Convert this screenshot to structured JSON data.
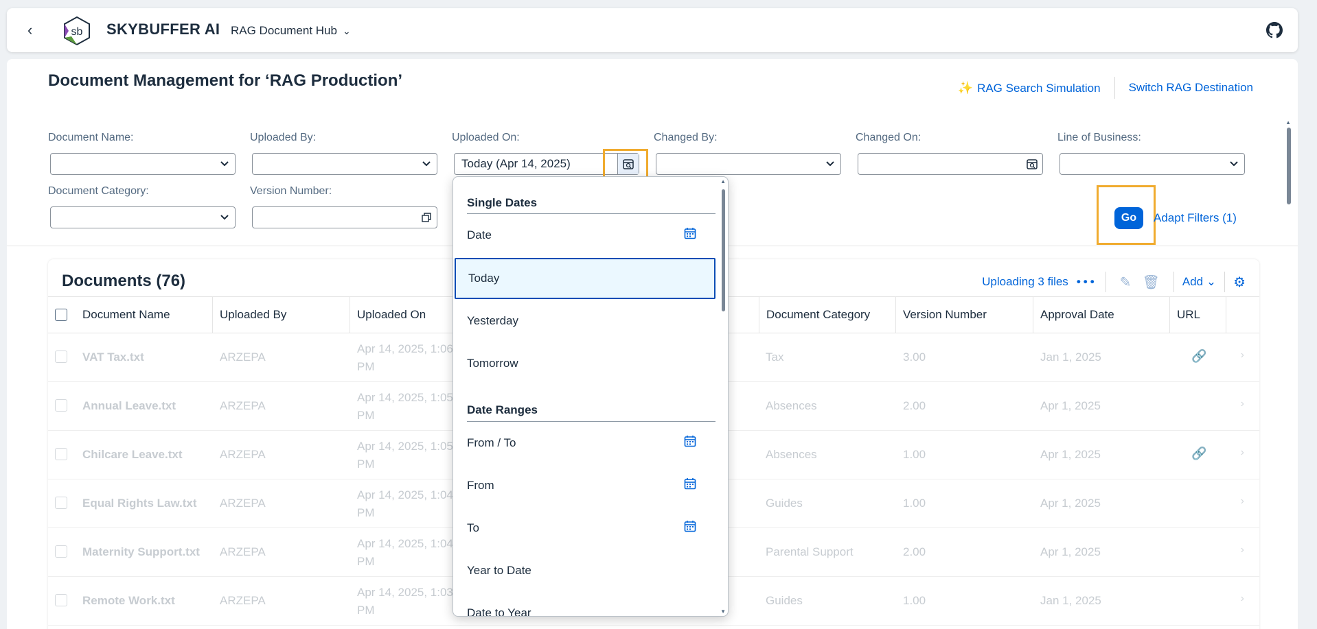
{
  "shell": {
    "brand": "SKYBUFFER AI",
    "logo_text": "sb",
    "app_title": "RAG Document Hub"
  },
  "page": {
    "title": "Document Management for ‘RAG Production’",
    "rag_search": "RAG Search Simulation",
    "switch_dest": "Switch RAG Destination"
  },
  "filters": {
    "document_name": "Document Name:",
    "uploaded_by": "Uploaded By:",
    "uploaded_on": "Uploaded On:",
    "uploaded_on_value": "Today (Apr 14, 2025)",
    "changed_by": "Changed By:",
    "changed_on": "Changed On:",
    "line_of_business": "Line of Business:",
    "document_category": "Document Category:",
    "version_number": "Version Number:",
    "go": "Go",
    "adapt": "Adapt Filters (1)"
  },
  "table": {
    "title": "Documents (76)",
    "uploading": "Uploading 3 files",
    "add": "Add",
    "columns": [
      "Document Name",
      "Uploaded By",
      "Uploaded On",
      "Document Category",
      "Version Number",
      "Approval Date",
      "URL"
    ],
    "rows": [
      {
        "name": "VAT Tax.txt",
        "by": "ARZEPA",
        "on1": "Apr 14, 2025, 1:06",
        "on2": "PM",
        "category": "Tax",
        "version": "3.00",
        "approval": "Jan 1, 2025",
        "link": true
      },
      {
        "name": "Annual Leave.txt",
        "by": "ARZEPA",
        "on1": "Apr 14, 2025, 1:05",
        "on2": "PM",
        "category": "Absences",
        "version": "2.00",
        "approval": "Apr 1, 2025",
        "link": false
      },
      {
        "name": "Chilcare Leave.txt",
        "by": "ARZEPA",
        "on1": "Apr 14, 2025, 1:05",
        "on2": "PM",
        "category": "Absences",
        "version": "1.00",
        "approval": "Apr 1, 2025",
        "link": true
      },
      {
        "name": "Equal Rights Law.txt",
        "by": "ARZEPA",
        "on1": "Apr 14, 2025, 1:04",
        "on2": "PM",
        "category": "Guides",
        "version": "1.00",
        "approval": "Apr 1, 2025",
        "link": false
      },
      {
        "name": "Maternity Support.txt",
        "by": "ARZEPA",
        "on1": "Apr 14, 2025, 1:04",
        "on2": "PM",
        "category": "Parental Support",
        "version": "2.00",
        "approval": "Apr 1, 2025",
        "link": false
      },
      {
        "name": "Remote Work.txt",
        "by": "ARZEPA",
        "on1": "Apr 14, 2025, 1:03",
        "on2": "PM",
        "category": "Guides",
        "version": "1.00",
        "approval": "Jan 1, 2025",
        "link": false
      }
    ]
  },
  "popover": {
    "single_dates": "Single Dates",
    "date": "Date",
    "today": "Today",
    "yesterday": "Yesterday",
    "tomorrow": "Tomorrow",
    "date_ranges": "Date Ranges",
    "from_to": "From / To",
    "from": "From",
    "to": "To",
    "year_to_date": "Year to Date",
    "date_to_year": "Date to Year"
  },
  "colors": {
    "accent": "#0064d9",
    "highlight": "#f0ab2e",
    "selected_bg": "#ebf8ff"
  }
}
